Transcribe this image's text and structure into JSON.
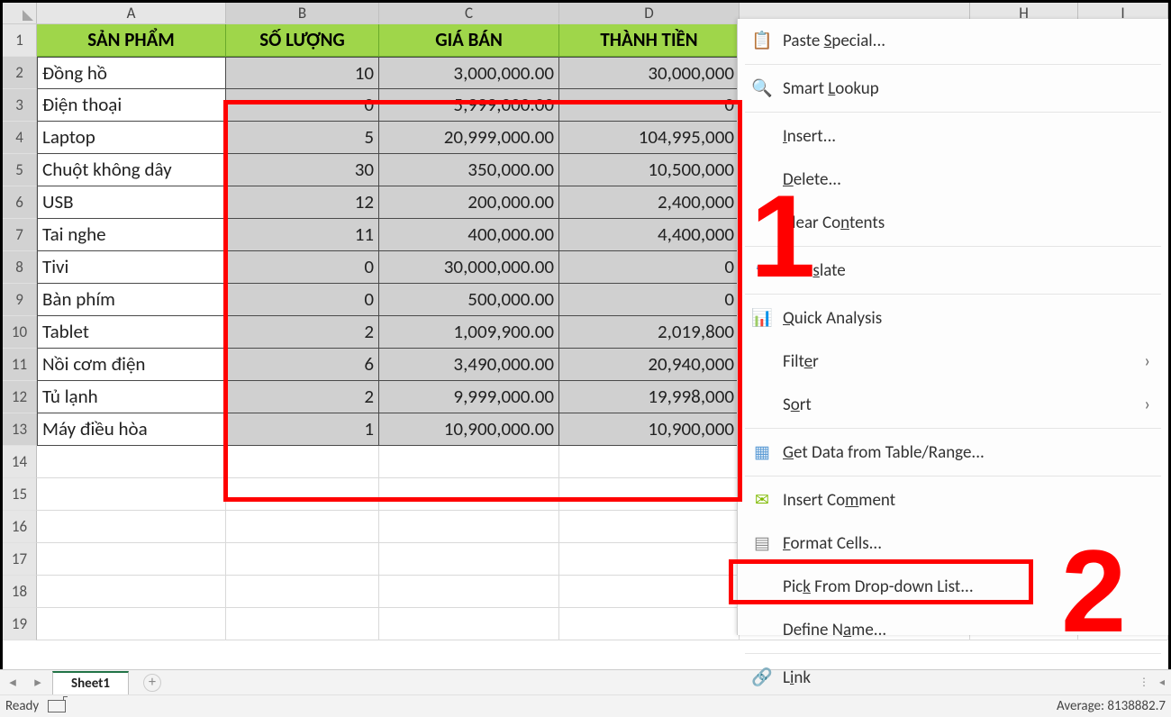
{
  "columns": [
    "A",
    "B",
    "C",
    "D",
    "H",
    "I"
  ],
  "row_numbers": [
    1,
    2,
    3,
    4,
    5,
    6,
    7,
    8,
    9,
    10,
    11,
    12,
    13,
    14,
    15,
    16,
    17,
    18,
    19
  ],
  "headers": {
    "A": "SẢN PHẨM",
    "B": "SỐ LƯỢNG",
    "C": "GIÁ BÁN",
    "D": "THÀNH TIỀN"
  },
  "rows": [
    {
      "A": "Đồng hồ",
      "B": "10",
      "C": "3,000,000.00",
      "D": "30,000,000"
    },
    {
      "A": "Điện thoại",
      "B": "0",
      "C": "5,999,000.00",
      "D": "0"
    },
    {
      "A": "Laptop",
      "B": "5",
      "C": "20,999,000.00",
      "D": "104,995,000"
    },
    {
      "A": "Chuột không dây",
      "B": "30",
      "C": "350,000.00",
      "D": "10,500,000"
    },
    {
      "A": "USB",
      "B": "12",
      "C": "200,000.00",
      "D": "2,400,000"
    },
    {
      "A": "Tai nghe",
      "B": "11",
      "C": "400,000.00",
      "D": "4,400,000"
    },
    {
      "A": "Tivi",
      "B": "0",
      "C": "30,000,000.00",
      "D": "0"
    },
    {
      "A": "Bàn phím",
      "B": "0",
      "C": "500,000.00",
      "D": "0"
    },
    {
      "A": "Tablet",
      "B": "2",
      "C": "1,009,900.00",
      "D": "2,019,800"
    },
    {
      "A": "Nồi cơm điện",
      "B": "6",
      "C": "3,490,000.00",
      "D": "20,940,000"
    },
    {
      "A": "Tủ lạnh",
      "B": "2",
      "C": "9,999,000.00",
      "D": "19,998,000"
    },
    {
      "A": "Máy điều hòa",
      "B": "1",
      "C": "10,900,000.00",
      "D": "10,900,000"
    }
  ],
  "context_menu": {
    "paste_special": "Paste Special...",
    "smart_lookup": "Smart Lookup",
    "insert": "Insert...",
    "delete": "Delete...",
    "clear_contents": "Clear Contents",
    "translate": "Translate",
    "quick_analysis": "Quick Analysis",
    "filter": "Filter",
    "sort": "Sort",
    "get_data": "Get Data from Table/Range...",
    "insert_comment": "Insert Comment",
    "format_cells": "Format Cells...",
    "pick_list": "Pick From Drop-down List...",
    "define_name": "Define Name...",
    "link": "Link"
  },
  "annotations": {
    "one": "1",
    "two": "2"
  },
  "sheet": {
    "name": "Sheet1"
  },
  "statusbar": {
    "ready": "Ready",
    "average": "Average: 8138882.7"
  }
}
